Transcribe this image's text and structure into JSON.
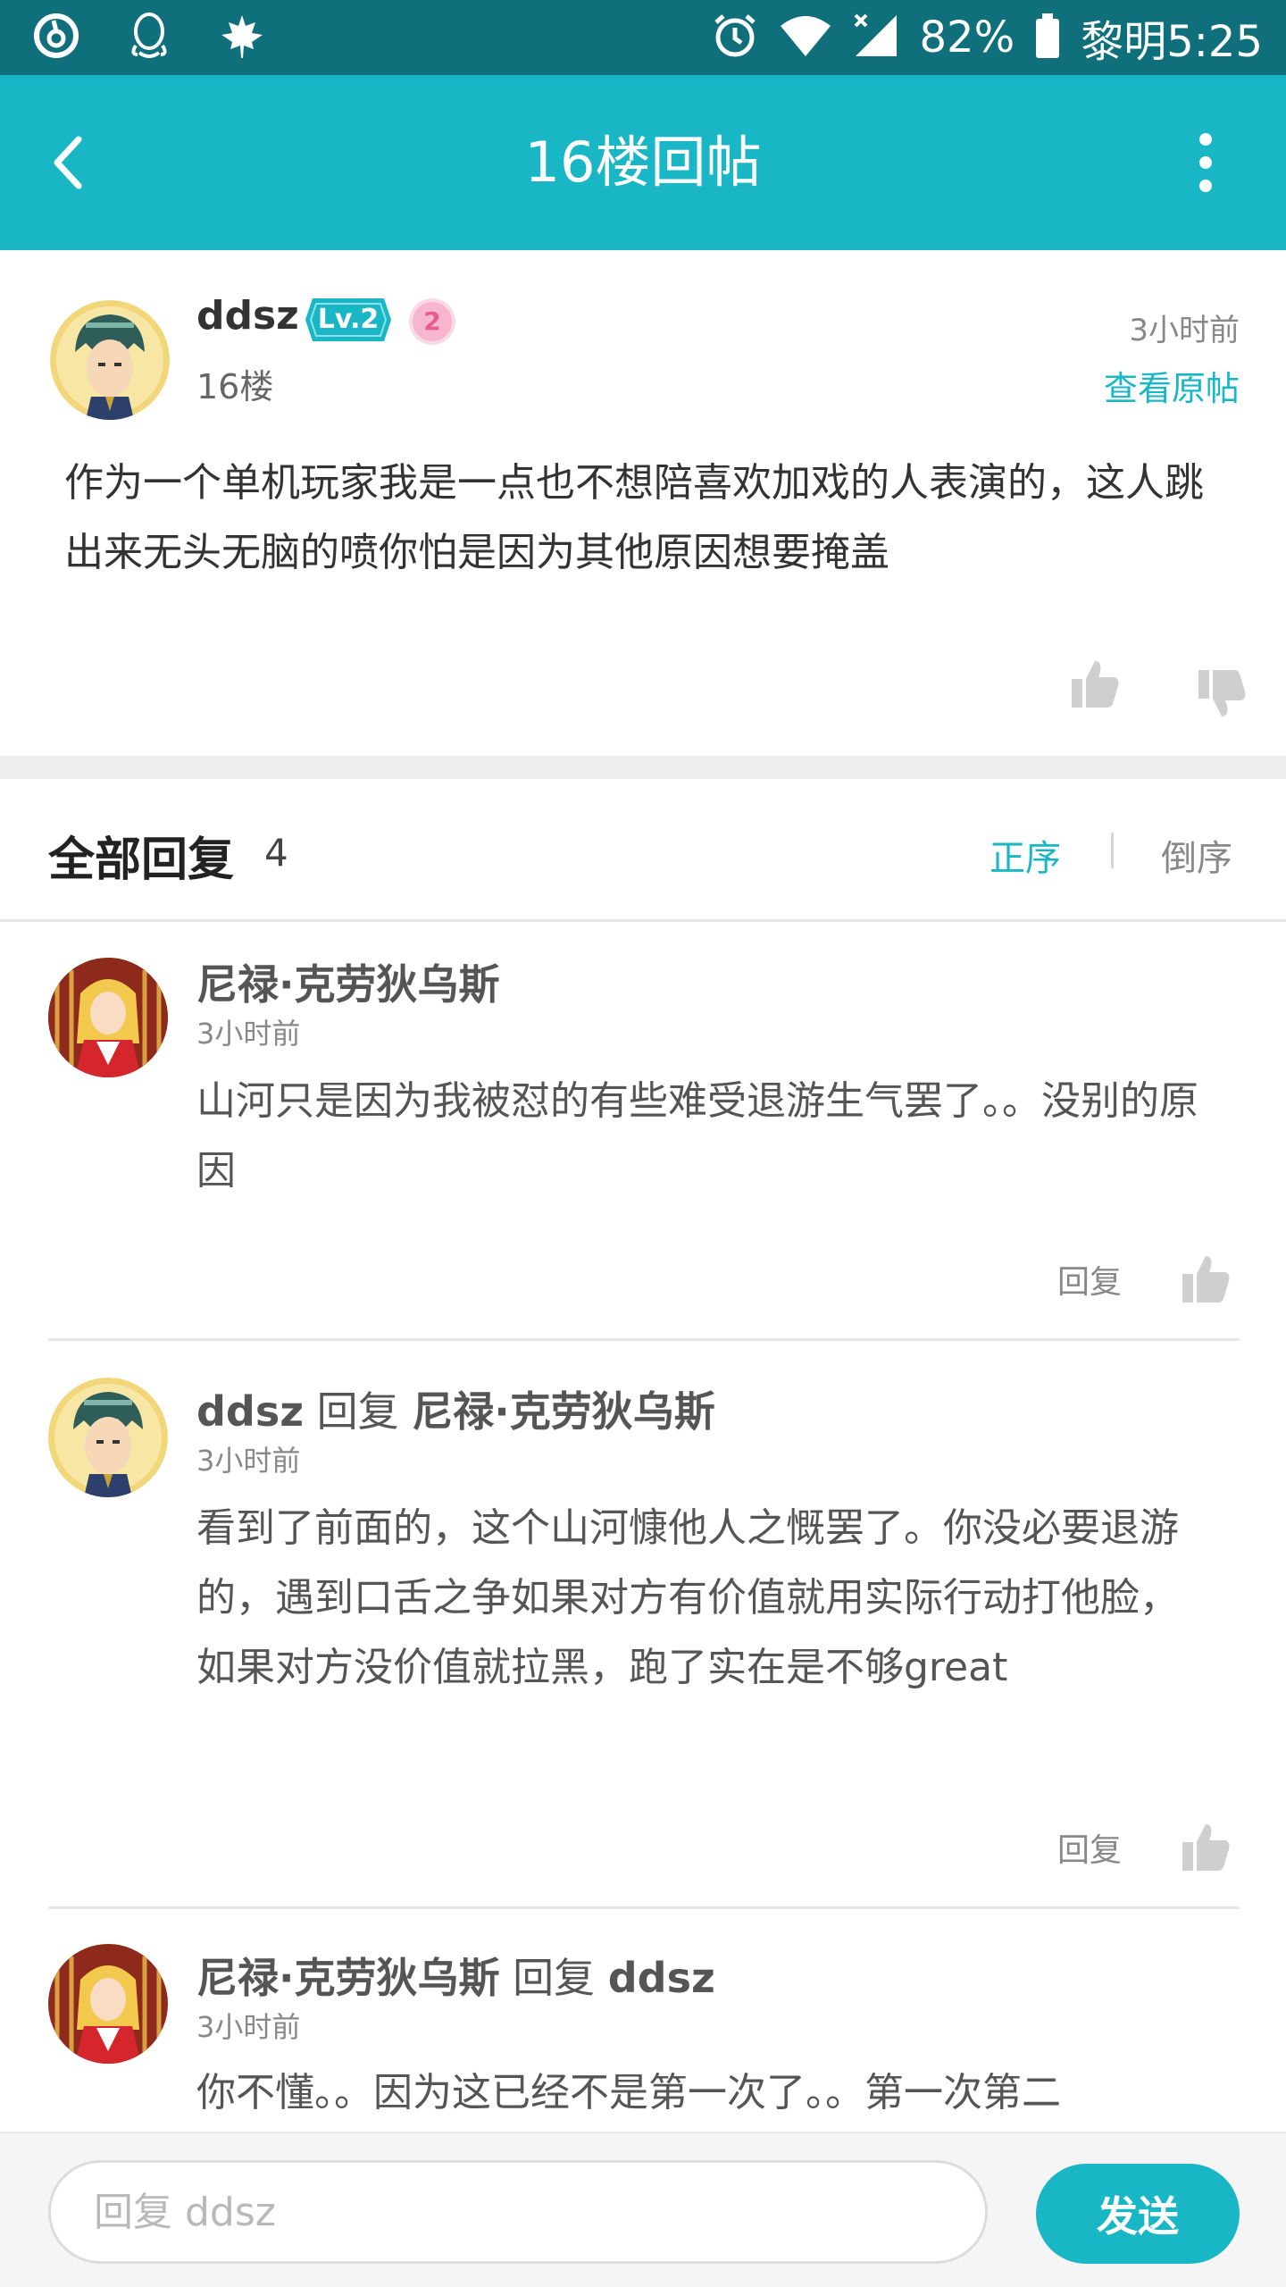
{
  "status_bar": {
    "battery": "82%",
    "time": "黎明5:25",
    "icons": [
      "netease-music-icon",
      "qq-icon",
      "maple-leaf-icon",
      "alarm-icon",
      "wifi-icon",
      "signal-icon",
      "battery-icon"
    ]
  },
  "app_bar": {
    "title": "16楼回帖",
    "back_icon": "chevron-left-icon",
    "more_icon": "more-vertical-icon"
  },
  "post": {
    "username": "ddsz",
    "level": "Lv.2",
    "medal": "2",
    "floor": "16楼",
    "time": "3小时前",
    "view_original": "查看原帖",
    "content": "作为一个单机玩家我是一点也不想陪喜欢加戏的人表演的，这人跳出来无头无脑的喷你怕是因为其他原因想要掩盖"
  },
  "replies": {
    "title": "全部回复",
    "count": "4",
    "sort_asc": "正序",
    "sort_desc": "倒序",
    "items": [
      {
        "author": "尼禄·克劳狄乌斯",
        "reply_word": "",
        "target": "",
        "time": "3小时前",
        "content": "山河只是因为我被怼的有些难受退游生气罢了。。没别的原因",
        "reply_label": "回复"
      },
      {
        "author": "ddsz",
        "reply_word": " 回复 ",
        "target": "尼禄·克劳狄乌斯",
        "time": "3小时前",
        "content": "看到了前面的，这个山河慷他人之慨罢了。你没必要退游的，遇到口舌之争如果对方有价值就用实际行动打他脸，如果对方没价值就拉黑，跑了实在是不够great",
        "reply_label": "回复"
      },
      {
        "author": "尼禄·克劳狄乌斯",
        "reply_word": " 回复 ",
        "target": "ddsz",
        "time": "3小时前",
        "content": "你不懂。。因为这已经不是第一次了。。第一次第二"
      }
    ]
  },
  "input_bar": {
    "placeholder": "回复 ddsz",
    "send": "发送"
  },
  "colors": {
    "accent": "#19b7c6",
    "status_bar": "#0f6f7b"
  }
}
